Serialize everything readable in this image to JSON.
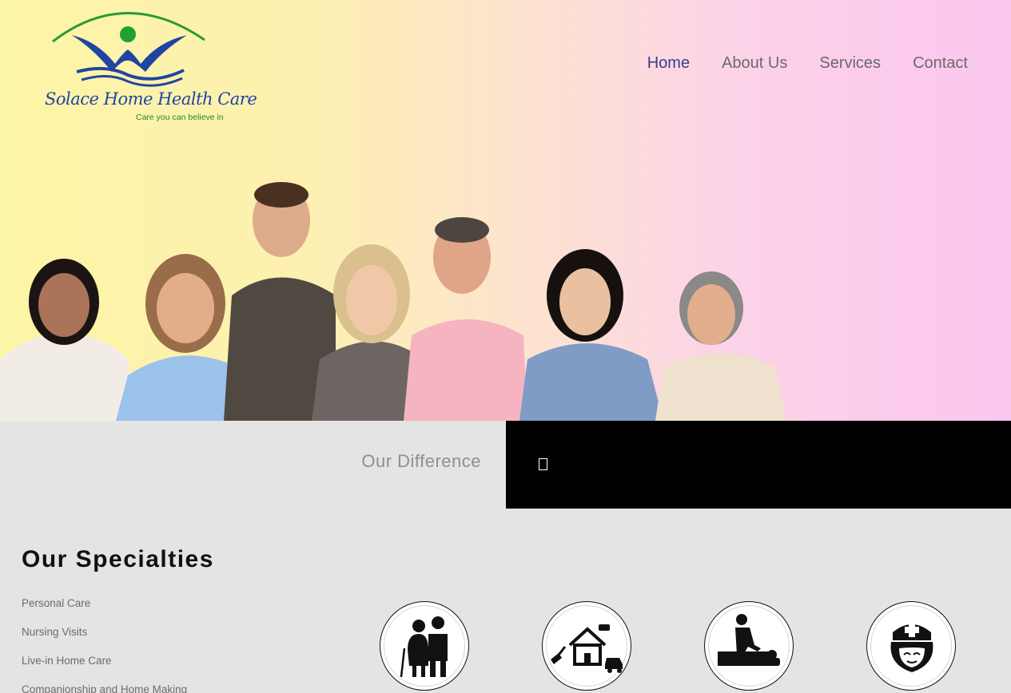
{
  "brand": {
    "name": "Solace Home Health Care",
    "tagline": "Care you can believe in"
  },
  "nav": {
    "items": [
      {
        "label": "Home",
        "active": true
      },
      {
        "label": "About Us",
        "active": false
      },
      {
        "label": "Services",
        "active": false
      },
      {
        "label": "Contact",
        "active": false
      }
    ]
  },
  "difference": {
    "title": "Our Difference",
    "glyph": "missing-glyph-box"
  },
  "specialties": {
    "title": "Our Specialties",
    "items": [
      "Personal Care",
      "Nursing Visits",
      "Live-in Home Care",
      "Companionship and Home Making"
    ],
    "icons": [
      "elderly-couple-icon",
      "home-services-icon",
      "massage-therapy-icon",
      "nurse-icon"
    ]
  },
  "colors": {
    "nav_active": "#3b3b8f",
    "nav_default": "#6a6a6a",
    "logo_blue": "#1f45a3",
    "logo_green": "#1d8a2d",
    "dark_panel": "#000000",
    "page_bg": "#e4e4e4"
  }
}
